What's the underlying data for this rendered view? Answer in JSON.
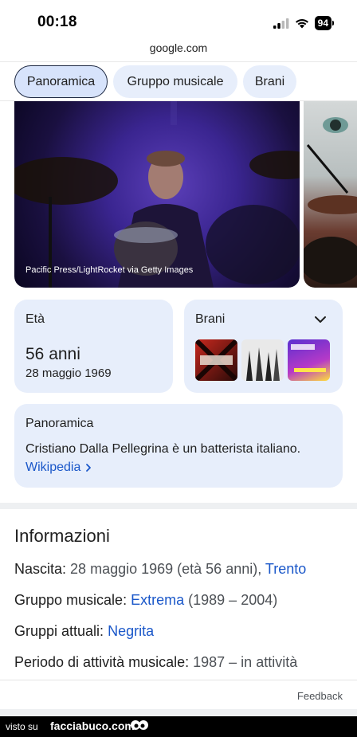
{
  "status_bar": {
    "time": "00:18",
    "battery": "94",
    "icons": [
      "signal-icon",
      "wifi-icon",
      "battery-icon"
    ]
  },
  "browser": {
    "url": "google.com"
  },
  "chips": [
    {
      "label": "Panoramica",
      "active": true
    },
    {
      "label": "Gruppo musicale",
      "active": false
    },
    {
      "label": "Brani",
      "active": false
    }
  ],
  "image": {
    "credit": "Pacific Press/LightRocket via Getty Images"
  },
  "age_card": {
    "label": "Età",
    "value": "56 anni",
    "date": "28 maggio 1969"
  },
  "songs_card": {
    "label": "Brani",
    "thumbnails": [
      "album-cover-1",
      "album-cover-2",
      "album-cover-3"
    ]
  },
  "overview_card": {
    "label": "Panoramica",
    "text": "Cristiano Dalla Pellegrina è un batterista italiano.",
    "source": "Wikipedia"
  },
  "info": {
    "title": "Informazioni",
    "birth_key": "Nascita:",
    "birth_val": "28 maggio 1969 (età 56 anni),",
    "birth_place": "Trento",
    "group_key": "Gruppo musicale:",
    "group_link": "Extrema",
    "group_years": "(1989 – 2004)",
    "current_key": "Gruppi attuali:",
    "current_link": "Negrita",
    "period_key": "Periodo di attività musicale:",
    "period_val": "1987 – in attività"
  },
  "feedback": "Feedback",
  "banner": {
    "prefix": "visto su",
    "site": "facciabuco.com"
  },
  "colors": {
    "chip_bg": "#e7eefb",
    "card_bg": "#e7eefb",
    "link": "#1a57c9"
  }
}
